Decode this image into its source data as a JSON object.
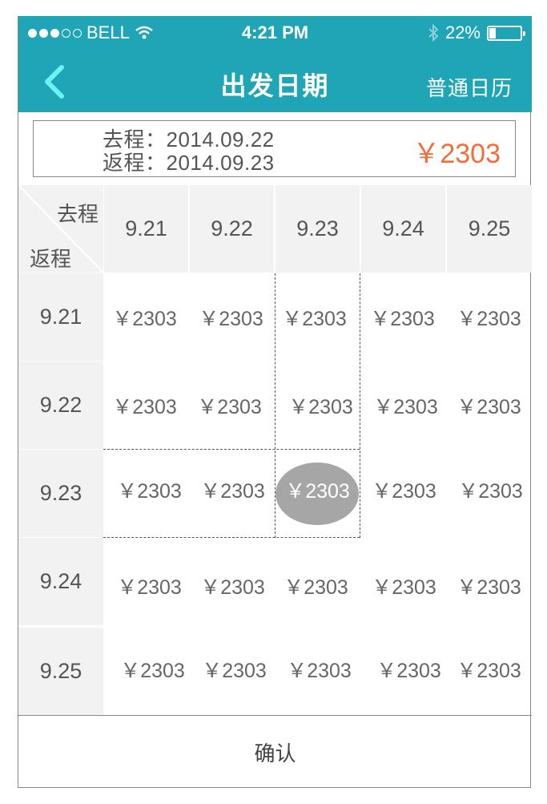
{
  "status_bar": {
    "carrier": "BELL",
    "time": "4:21 PM",
    "battery_percent": "22%",
    "battery_level": 0.22,
    "signal_icon": "signal-dots-icon",
    "wifi_icon": "wifi-icon",
    "bluetooth_icon": "bluetooth-icon",
    "battery_icon": "battery-icon"
  },
  "nav": {
    "title": "出发日期",
    "right_label": "普通日历",
    "back_icon": "chevron-left-icon"
  },
  "summary": {
    "outbound": "去程：2014.09.22",
    "return": "返程：2014.09.23",
    "price": "￥2303"
  },
  "grid": {
    "corner_top": "去程",
    "corner_bottom": "返程",
    "columns": [
      "9.21",
      "9.22",
      "9.23",
      "9.24",
      "9.25"
    ],
    "rows": [
      {
        "label": "9.21",
        "prices": [
          "￥2303",
          "￥2303",
          "￥2303",
          "￥2303",
          "￥2303"
        ]
      },
      {
        "label": "9.22",
        "prices": [
          "￥2303",
          "￥2303",
          "￥2303",
          "￥2303",
          "￥2303"
        ]
      },
      {
        "label": "9.23",
        "prices": [
          "￥2303",
          "￥2303",
          "￥2303",
          "￥2303",
          "￥2303"
        ]
      },
      {
        "label": "9.24",
        "prices": [
          "￥2303",
          "￥2303",
          "￥2303",
          "￥2303",
          "￥2303"
        ]
      },
      {
        "label": "9.25",
        "prices": [
          "￥2303",
          "￥2303",
          "￥2303",
          "￥2303",
          "￥2303"
        ]
      }
    ],
    "selected": {
      "row": 2,
      "col": 2
    }
  },
  "confirm_label": "确认",
  "colors": {
    "brand": "#1fa5b6",
    "price_accent": "#f36c3c",
    "back_arrow": "#6ff0f2",
    "selected": "#a6a6a6"
  }
}
